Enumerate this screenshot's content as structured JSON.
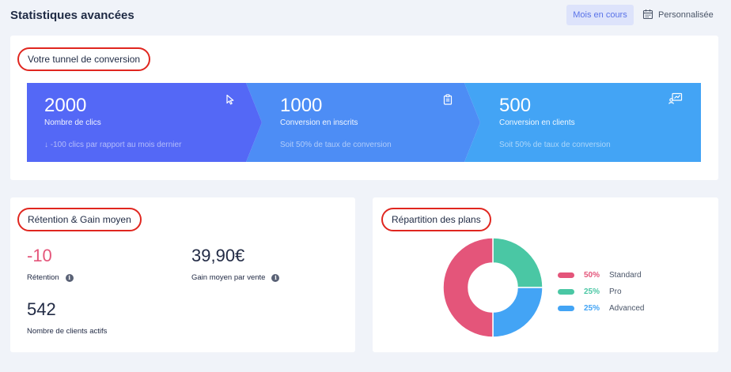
{
  "header": {
    "title": "Statistiques avancées",
    "period_button": "Mois en cours",
    "custom_button": "Personnalisée",
    "custom_icon": "calendar-icon"
  },
  "funnel": {
    "title": "Votre tunnel de conversion",
    "steps": [
      {
        "value": "2000",
        "label": "Nombre de clics",
        "sub": "↓ -100 clics par rapport au mois dernier",
        "icon": "cursor-icon",
        "color": "#5468f6"
      },
      {
        "value": "1000",
        "label": "Conversion en inscrits",
        "sub": "Soit 50% de taux de conversion",
        "icon": "clipboard-icon",
        "color": "#4d8df5"
      },
      {
        "value": "500",
        "label": "Conversion en clients",
        "sub": "Soit 50% de taux de conversion",
        "icon": "customer-chart-icon",
        "color": "#43a4f5"
      }
    ]
  },
  "retention": {
    "title": "Rétention & Gain moyen",
    "metrics": [
      {
        "value": "-10",
        "label": "Rétention"
      },
      {
        "value": "39,90€",
        "label": "Gain moyen par vente"
      },
      {
        "value": "542",
        "label": "Nombre de clients actifs"
      }
    ],
    "info_glyph": "i",
    "negative_color": "#e4557a"
  },
  "plans": {
    "title": "Répartition des plans",
    "items": [
      {
        "pct": "50%",
        "name": "Standard",
        "value": 50,
        "color": "#e4557a"
      },
      {
        "pct": "25%",
        "name": "Pro",
        "value": 25,
        "color": "#4ac7a4"
      },
      {
        "pct": "25%",
        "name": "Advanced",
        "value": 25,
        "color": "#43a4f5"
      }
    ]
  }
}
